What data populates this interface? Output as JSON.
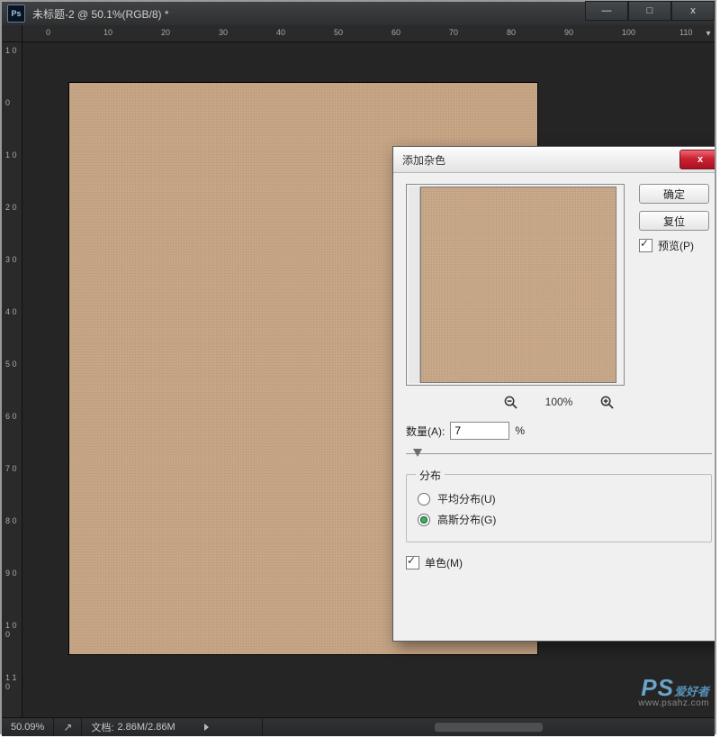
{
  "window": {
    "app_badge": "Ps",
    "doc_title": "未标题-2 @ 50.1%(RGB/8) *",
    "controls": {
      "minimize": "—",
      "restore": "□",
      "close": "x"
    }
  },
  "ruler_top": [
    "0",
    "10",
    "20",
    "30",
    "40",
    "50",
    "60",
    "70",
    "80",
    "90",
    "100",
    "110"
  ],
  "ruler_left": [
    "1\n0",
    "0",
    "1\n0",
    "2\n0",
    "3\n0",
    "4\n0",
    "5\n0",
    "6\n0",
    "7\n0",
    "8\n0",
    "9\n0",
    "1\n0\n0",
    "1\n1\n0"
  ],
  "dialog": {
    "title": "添加杂色",
    "close": "x",
    "buttons": {
      "ok": "确定",
      "reset": "复位"
    },
    "preview_label": "预览(P)",
    "preview_checked": true,
    "zoom": {
      "level": "100%",
      "out_icon": "zoom-out-icon",
      "in_icon": "zoom-in-icon"
    },
    "amount": {
      "label": "数量(A):",
      "value": "7",
      "unit": "%"
    },
    "distribution": {
      "group_label": "分布",
      "uniform": "平均分布(U)",
      "gaussian": "高斯分布(G)",
      "selected": "gaussian"
    },
    "monochrome": {
      "label": "单色(M)",
      "checked": true
    }
  },
  "statusbar": {
    "zoom": "50.09%",
    "docinfo_label": "文档:",
    "docinfo_value": "2.86M/2.86M"
  },
  "watermark": {
    "brand": "PS",
    "sub": "爱好者",
    "url": "www.psahz.com"
  }
}
